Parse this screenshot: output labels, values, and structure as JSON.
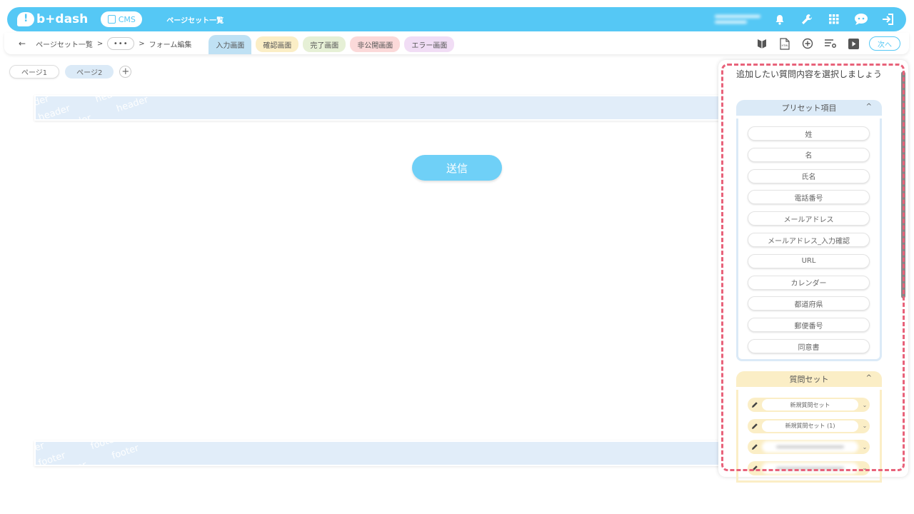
{
  "app": {
    "logo_text": "b+dash",
    "cms_label": "CMS",
    "top_title": "ページセット一覧"
  },
  "topbar": {
    "user_blurred": true,
    "icons": [
      "bell-icon",
      "wrench-icon",
      "grid-icon",
      "chat-bot-icon",
      "logout-icon"
    ]
  },
  "breadcrumb": {
    "back": "←",
    "item1": "ページセット一覧",
    "separator": ">",
    "more": "•••",
    "current": "フォーム編集"
  },
  "tabs": {
    "input": "入力画面",
    "confirm": "確認画面",
    "done": "完了画面",
    "private": "非公開画面",
    "error": "エラー画面"
  },
  "toolbar": {
    "icons": [
      "guide-icon",
      "html-file-icon",
      "add-circle-icon",
      "list-settings-icon",
      "play-icon"
    ],
    "next_label": "次へ"
  },
  "pages": {
    "page1": "ページ1",
    "page2": "ページ2",
    "add": "+"
  },
  "canvas": {
    "header_word": "header",
    "footer_word": "footer",
    "submit_label": "送信"
  },
  "panel": {
    "title": "追加したい質問内容を選択しましょう",
    "preset_title": "プリセット項目",
    "preset_items": [
      "姓",
      "名",
      "氏名",
      "電話番号",
      "メールアドレス",
      "メールアドレス_入力確認",
      "URL",
      "カレンダー",
      "都道府県",
      "郵便番号",
      "同意書"
    ],
    "qset_title": "質問セット",
    "qset_items": [
      "新規質問セット",
      "新規質問セット (1)"
    ],
    "chevron": "^",
    "row_chevron": "⌄"
  },
  "colors": {
    "accent": "#55c8f5",
    "highlight_dash": "#e8627a"
  }
}
